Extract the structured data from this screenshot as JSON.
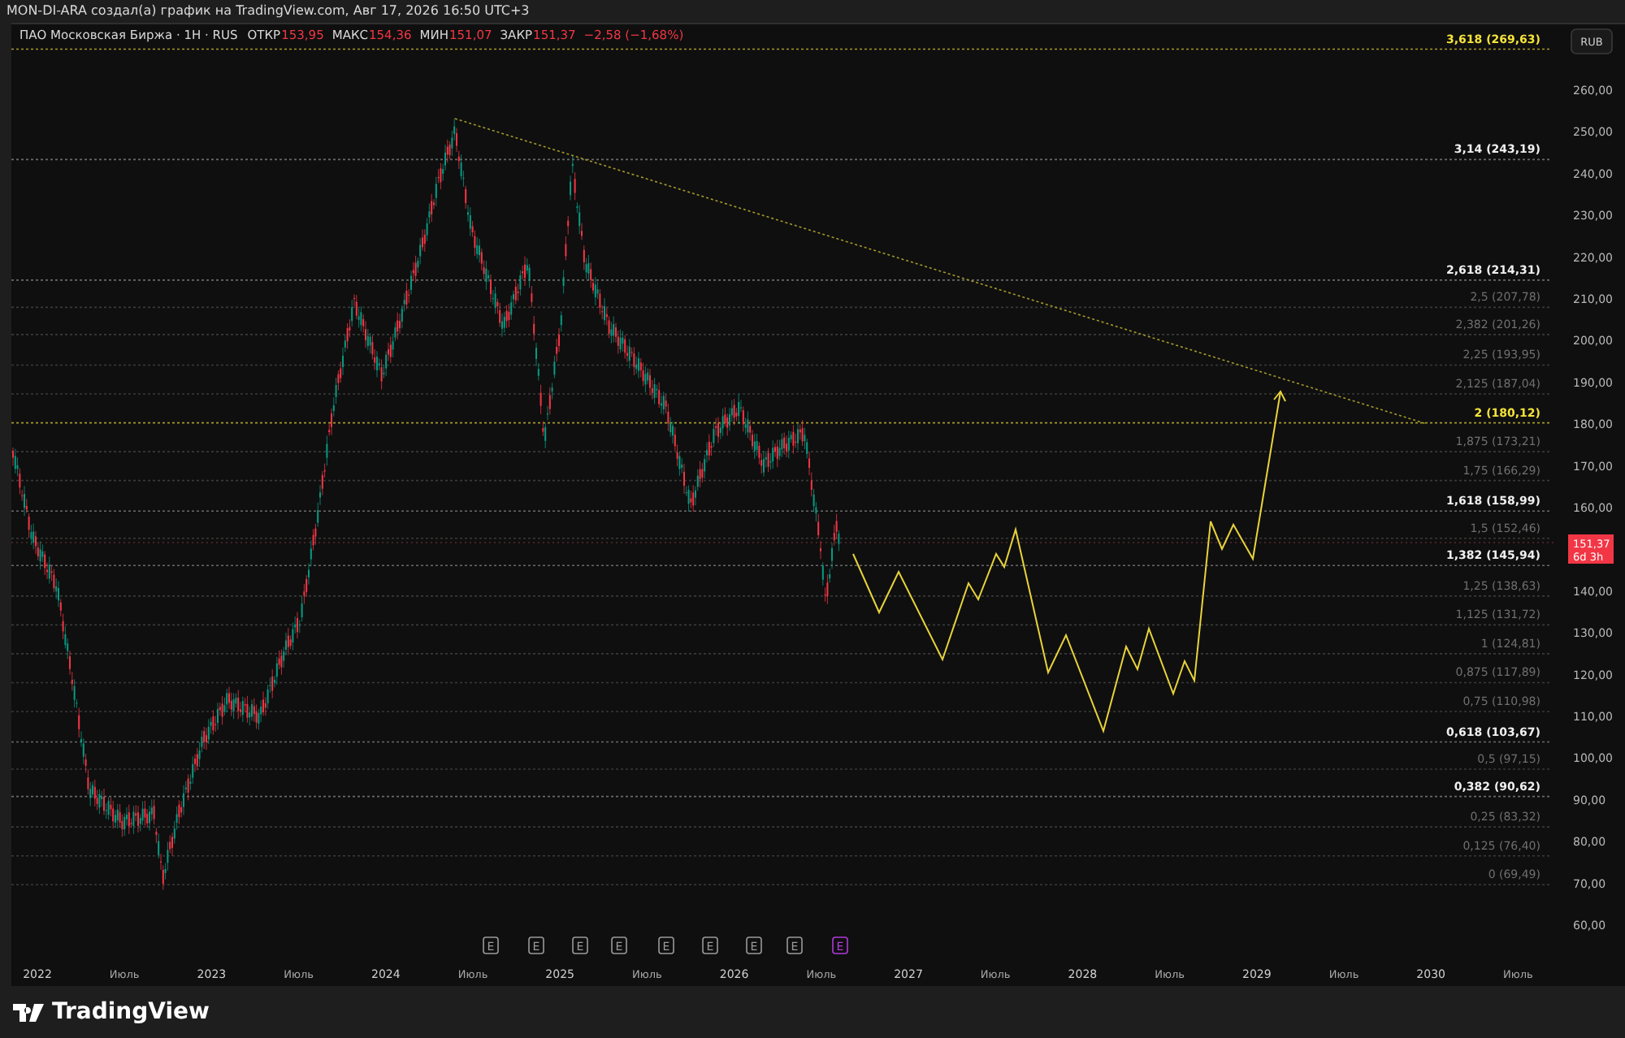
{
  "header": {
    "text": "MON-DI-ARA создал(а) график на TradingView.com, Авг 17, 2026 16:50 UTC+3"
  },
  "legend": {
    "symbol": "ПАО Московская Биржа · 1H · RUS",
    "fields": [
      {
        "label": "ОТКР",
        "value": "153,95"
      },
      {
        "label": "МАКС",
        "value": "154,36"
      },
      {
        "label": "МИН",
        "value": "151,07"
      },
      {
        "label": "ЗАКР",
        "value": "151,37"
      }
    ],
    "change": "−2,58 (−1,68%)"
  },
  "currency_button": "RUB",
  "fib_levels": [
    {
      "label": "3,618 (269,63)",
      "kind": "key"
    },
    {
      "label": "3,14 (243,19)",
      "kind": "major"
    },
    {
      "label": "2,618 (214,31)",
      "kind": "major"
    },
    {
      "label": "2,5 (207,78)",
      "kind": "minor"
    },
    {
      "label": "2,382 (201,26)",
      "kind": "minor"
    },
    {
      "label": "2,25 (193,95)",
      "kind": "minor"
    },
    {
      "label": "2,125 (187,04)",
      "kind": "minor"
    },
    {
      "label": "2 (180,12)",
      "kind": "key"
    },
    {
      "label": "1,875 (173,21)",
      "kind": "minor"
    },
    {
      "label": "1,75 (166,29)",
      "kind": "minor"
    },
    {
      "label": "1,618 (158,99)",
      "kind": "major"
    },
    {
      "label": "1,5 (152,46)",
      "kind": "minor"
    },
    {
      "label": "1,382 (145,94)",
      "kind": "major"
    },
    {
      "label": "1,25 (138,63)",
      "kind": "minor"
    },
    {
      "label": "1,125 (131,72)",
      "kind": "minor"
    },
    {
      "label": "1 (124,81)",
      "kind": "minor"
    },
    {
      "label": "0,875 (117,89)",
      "kind": "minor"
    },
    {
      "label": "0,75 (110,98)",
      "kind": "minor"
    },
    {
      "label": "0,618 (103,67)",
      "kind": "major"
    },
    {
      "label": "0,5 (97,15)",
      "kind": "minor"
    },
    {
      "label": "0,382 (90,62)",
      "kind": "major"
    },
    {
      "label": "0,25 (83,32)",
      "kind": "minor"
    },
    {
      "label": "0,125 (76,40)",
      "kind": "minor"
    },
    {
      "label": "0 (69,49)",
      "kind": "minor"
    }
  ],
  "y_axis": [
    "260,00",
    "250,00",
    "240,00",
    "230,00",
    "220,00",
    "210,00",
    "200,00",
    "190,00",
    "180,00",
    "170,00",
    "160,00",
    "140,00",
    "130,00",
    "120,00",
    "110,00",
    "100,00",
    "90,00",
    "80,00",
    "70,00",
    "60,00"
  ],
  "price_tag": {
    "price": "151,37",
    "countdown": "6d 3h"
  },
  "x_axis": [
    "2022",
    "Июль",
    "2023",
    "Июль",
    "2024",
    "Июль",
    "2025",
    "Июль",
    "2026",
    "Июль",
    "2027",
    "Июль",
    "2028",
    "Июль",
    "2029",
    "Июль",
    "2030",
    "Июль"
  ],
  "earnings": [
    {
      "label": "E",
      "kind": "past"
    },
    {
      "label": "E",
      "kind": "past"
    },
    {
      "label": "E",
      "kind": "past"
    },
    {
      "label": "E",
      "kind": "past"
    },
    {
      "label": "E",
      "kind": "past"
    },
    {
      "label": "E",
      "kind": "past"
    },
    {
      "label": "E",
      "kind": "past"
    },
    {
      "label": "E",
      "kind": "past"
    },
    {
      "label": "E",
      "kind": "upcoming"
    }
  ],
  "footer": {
    "brand": "TradingView"
  }
}
